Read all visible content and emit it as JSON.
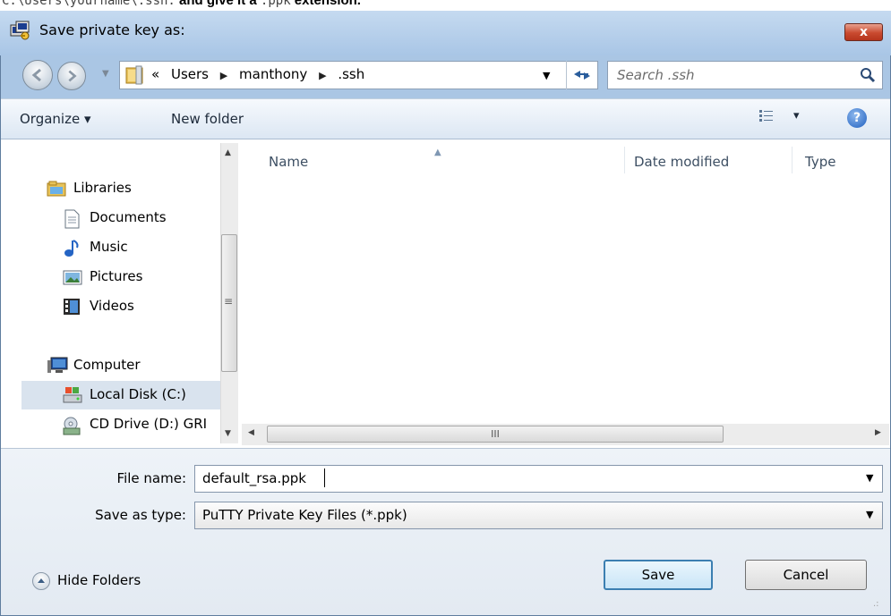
{
  "instruction": {
    "path": "C:\\Users\\yourname\\.ssh.",
    "text_mid": " and give it a ",
    "ext": ".ppk",
    "text_end": " extension."
  },
  "window": {
    "title": "Save private key as:",
    "close_label": "x"
  },
  "address_bar": {
    "overflow": "«",
    "crumbs": [
      "Users",
      "manthony",
      ".ssh"
    ]
  },
  "search": {
    "placeholder": "Search .ssh"
  },
  "toolbar": {
    "organize": "Organize ▾",
    "new_folder": "New folder",
    "view_dd": "▾",
    "help": "?"
  },
  "nav_pane": {
    "libraries": "Libraries",
    "documents": "Documents",
    "music": "Music",
    "pictures": "Pictures",
    "videos": "Videos",
    "computer": "Computer",
    "local_disk": "Local Disk (C:)",
    "cd_drive": "CD Drive (D:) GRI"
  },
  "columns": {
    "name": "Name",
    "date_modified": "Date modified",
    "type": "Type"
  },
  "form": {
    "file_name_label": "File name:",
    "file_name_value": "default_rsa.ppk",
    "save_type_label": "Save as type:",
    "save_type_value": "PuTTY Private Key Files (*.ppk)"
  },
  "footer": {
    "hide_folders": "Hide Folders",
    "save": "Save",
    "cancel": "Cancel"
  },
  "scroll": {
    "h_grip": "III",
    "v_grip": "≡"
  }
}
